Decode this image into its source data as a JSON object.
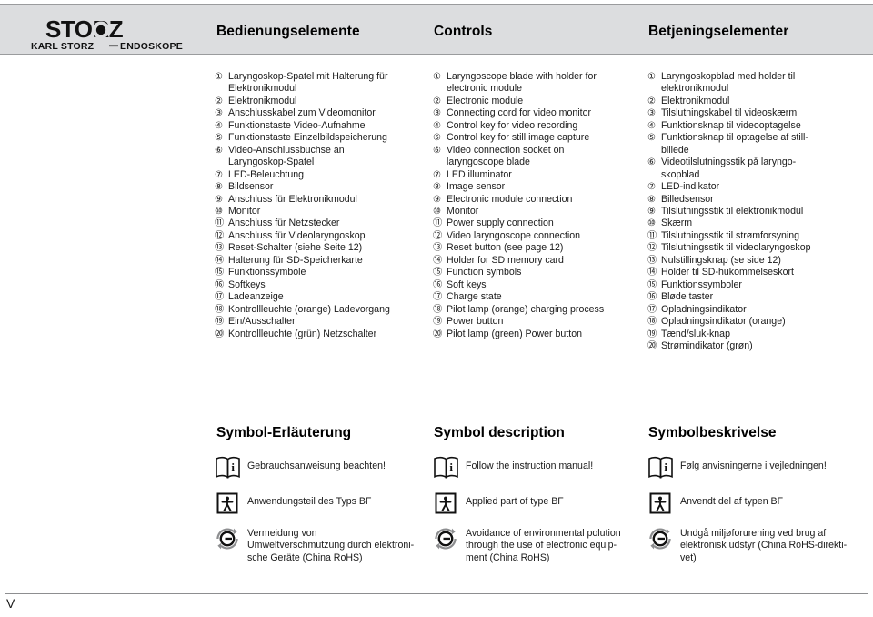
{
  "header": {
    "logo_word": "STORZ",
    "logo_sub_left": "KARL STORZ",
    "logo_sub_right": "ENDOSKOPE",
    "title_de": "Bedienungselemente",
    "title_en": "Controls",
    "title_da": "Betjeningselementer"
  },
  "numbers": [
    "①",
    "②",
    "③",
    "④",
    "⑤",
    "⑥",
    "⑦",
    "⑧",
    "⑨",
    "⑩",
    "⑪",
    "⑫",
    "⑬",
    "⑭",
    "⑮",
    "⑯",
    "⑰",
    "⑱",
    "⑲",
    "⑳"
  ],
  "controls": {
    "de": [
      "Laryngoskop-Spatel mit Halterung für\nElektronikmodul",
      "Elektronikmodul",
      "Anschlusskabel zum Videomonitor",
      "Funktionstaste Video-Aufnahme",
      "Funktionstaste Einzelbildspeicherung",
      "Video-Anschlussbuchse an\nLaryngoskop-Spatel",
      "LED-Beleuchtung",
      "Bildsensor",
      "Anschluss für Elektronikmodul",
      "Monitor",
      "Anschluss für Netzstecker",
      "Anschluss für Videolaryngoskop",
      "Reset-Schalter (siehe Seite 12)",
      "Halterung für SD-Speicherkarte",
      "Funktionssymbole",
      "Softkeys",
      "Ladeanzeige",
      "Kontrollleuchte (orange) Ladevorgang",
      "Ein/Ausschalter",
      "Kontrollleuchte (grün) Netzschalter"
    ],
    "en": [
      "Laryngoscope blade with holder for\nelectronic module",
      "Electronic module",
      "Connecting cord for video monitor",
      "Control key for video recording",
      "Control key for still image capture",
      "Video connection socket on\nlaryngoscope blade",
      "LED illuminator",
      "Image sensor",
      "Electronic module connection",
      "Monitor",
      "Power supply connection",
      "Video laryngoscope connection",
      "Reset button (see page 12)",
      "Holder for SD memory card",
      "Function symbols",
      "Soft keys",
      "Charge state",
      "Pilot lamp (orange) charging process",
      "Power button",
      "Pilot lamp (green) Power button"
    ],
    "da": [
      "Laryngoskopblad med holder til\nelektronikmodul",
      "Elektronikmodul",
      "Tilslutningskabel til videoskærm",
      "Funktionsknap til videooptagelse",
      "Funktionsknap til optagelse af still-\nbillede",
      "Videotilslutningsstik på laryngo-\nskopblad",
      "LED-indikator",
      "Billedsensor",
      "Tilslutningsstik til elektronikmodul",
      "Skærm",
      "Tilslutningsstik til strømforsyning",
      "Tilslutningsstik til videolaryngoskop",
      "Nulstillingsknap (se side 12)",
      "Holder til SD-hukommelseskort",
      "Funktionssymboler",
      "Bløde taster",
      "Opladningsindikator",
      "Opladningsindikator (orange)",
      "Tænd/sluk-knap",
      "Strømindikator (grøn)"
    ]
  },
  "symbol_section": {
    "heading_de": "Symbol-Erläuterung",
    "heading_en": "Symbol description",
    "heading_da": "Symbolbeskrivelse",
    "icons": [
      "manual-book-info-icon",
      "type-bf-applied-part-icon",
      "china-rohs-icon"
    ],
    "rows_de": [
      "Gebrauchsanweisung beachten!",
      "Anwendungsteil des Typs BF",
      "Vermeidung von\nUmweltverschmutzung durch elektroni-\nsche Geräte (China RoHS)"
    ],
    "rows_en": [
      "Follow the instruction manual!",
      "Applied part of type BF",
      "Avoidance of environmental polution\nthrough the use of electronic equip-\nment (China RoHS)"
    ],
    "rows_da": [
      "Følg anvisningerne i vejledningen!",
      "Anvendt del af typen BF",
      "Undgå miljøforurening ved brug af\nelektronisk udstyr (China RoHS-direkti-\nvet)"
    ]
  },
  "footer": {
    "page_marker": "V"
  },
  "colors": {
    "header_band": "#dcdddf",
    "rule": "#8d8e90",
    "text": "#1a1a1a"
  }
}
